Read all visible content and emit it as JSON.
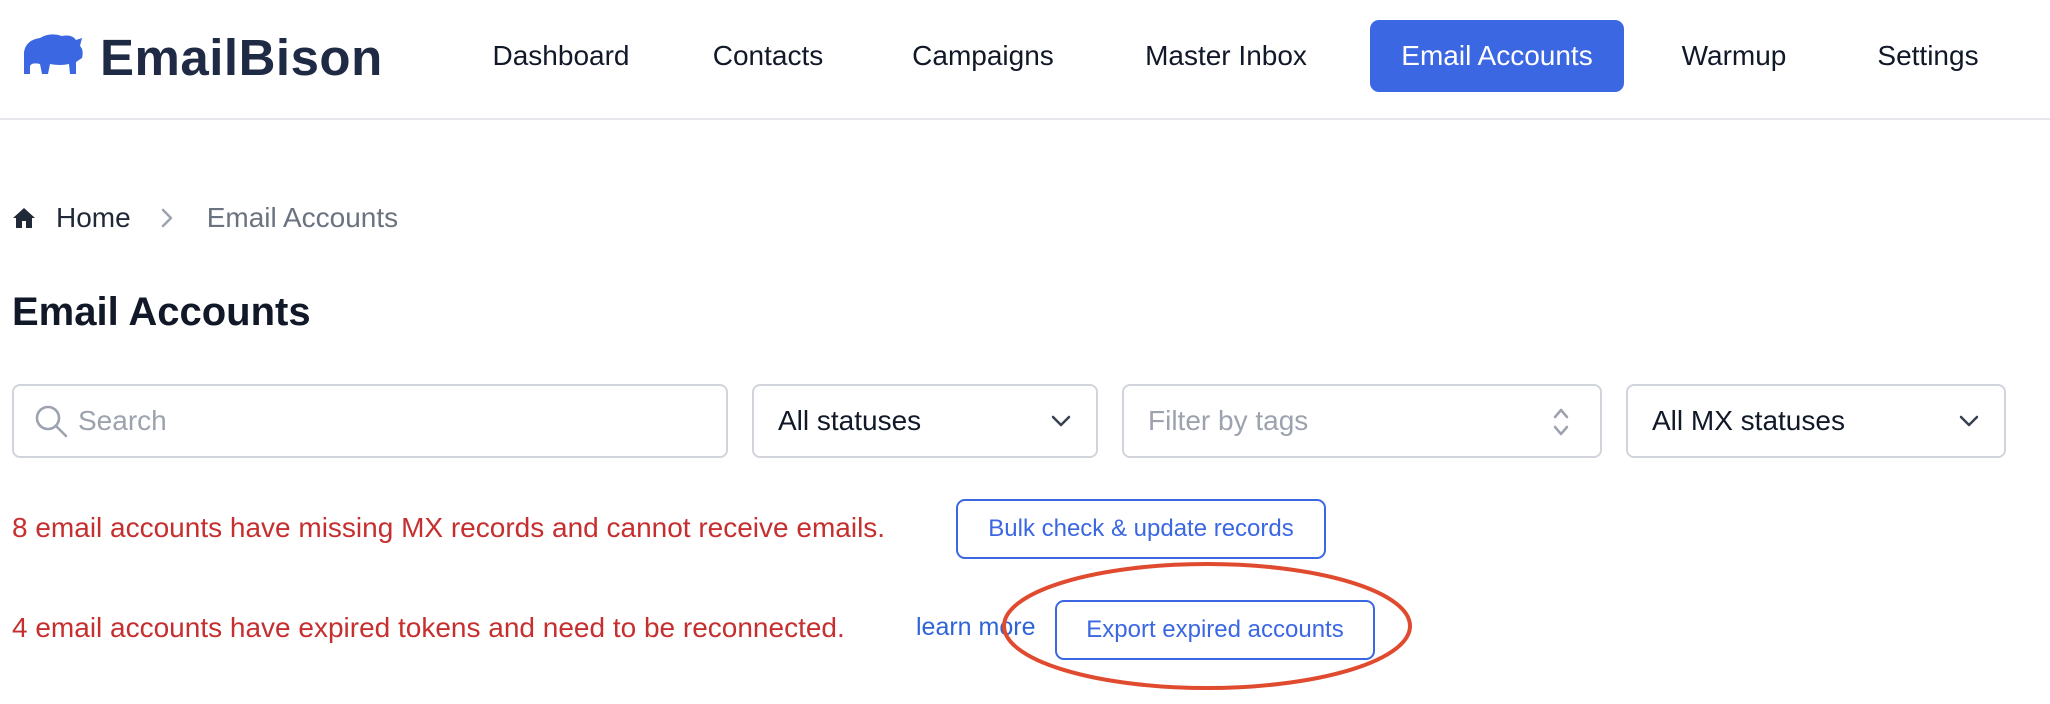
{
  "brand": {
    "name": "EmailBison",
    "logo_icon": "bison-icon",
    "color": "#1f2a44"
  },
  "nav": {
    "items": [
      {
        "label": "Dashboard"
      },
      {
        "label": "Contacts"
      },
      {
        "label": "Campaigns"
      },
      {
        "label": "Master Inbox"
      },
      {
        "label": "Email Accounts",
        "active": true
      },
      {
        "label": "Warmup"
      },
      {
        "label": "Settings"
      }
    ],
    "accent_color": "#3b67e3"
  },
  "breadcrumb": {
    "home_label": "Home",
    "current_label": "Email Accounts",
    "home_icon": "home-icon",
    "separator_icon": "chevron-right-icon"
  },
  "page": {
    "title": "Email Accounts"
  },
  "filters": {
    "search": {
      "placeholder": "Search",
      "icon": "search-icon"
    },
    "status": {
      "selected": "All statuses",
      "icon": "chevron-down-icon"
    },
    "tags": {
      "placeholder": "Filter by tags",
      "icon": "chevron-up-down-icon"
    },
    "mx_status": {
      "selected": "All MX statuses",
      "icon": "chevron-down-icon"
    }
  },
  "alerts": {
    "mx": {
      "message": "8 email accounts have missing MX records and cannot receive emails.",
      "button_label": "Bulk check & update records"
    },
    "tokens": {
      "message": "4 email accounts have expired tokens and need to be reconnected.",
      "link_label": "learn more",
      "button_label": "Export expired accounts"
    },
    "alert_color": "#c62f2f"
  },
  "annotation": {
    "shape": "ellipse",
    "color": "#e04a2f"
  }
}
